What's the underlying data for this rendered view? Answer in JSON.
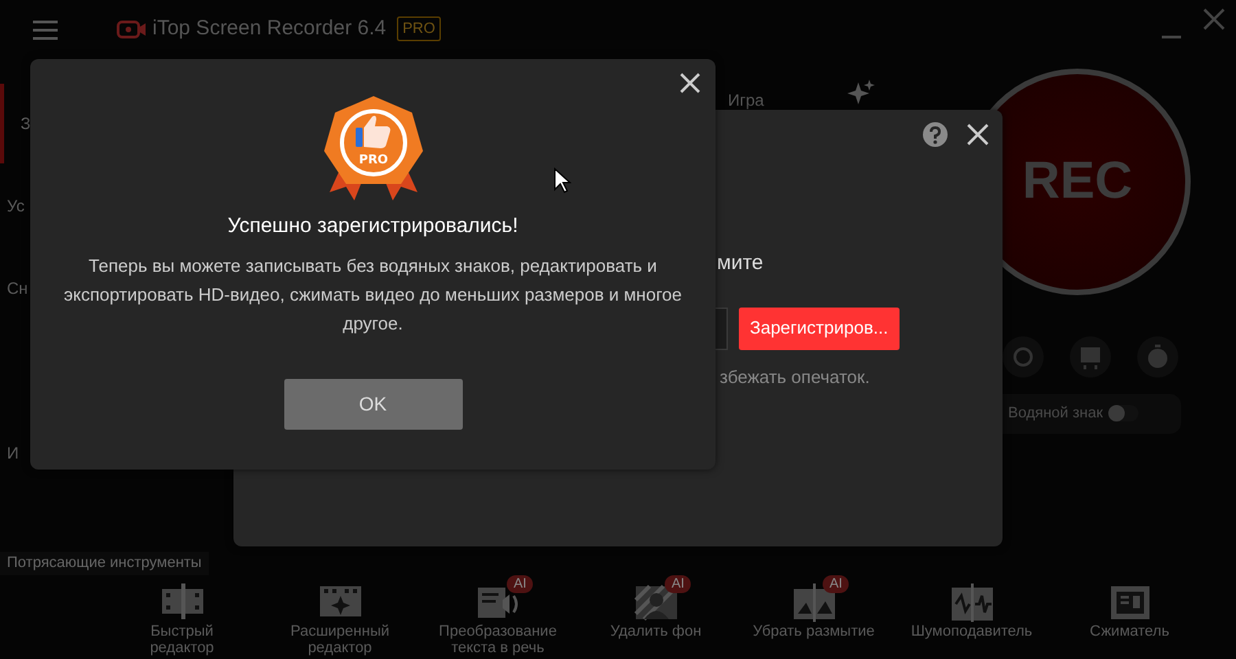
{
  "app": {
    "title": "iTop Screen Recorder 6.4",
    "badge": "PRO"
  },
  "sidebar": {
    "items": [
      {
        "label": "З",
        "selected": true
      },
      {
        "label": "Ус",
        "selected": false
      },
      {
        "label": "Сн",
        "selected": false
      },
      {
        "label": "И",
        "selected": false
      }
    ]
  },
  "mode_tabs": [
    {
      "label": "Игра"
    }
  ],
  "register_dialog": {
    "instruction": "мите",
    "button": "Зарегистриров...",
    "hint": "збежать опечаток."
  },
  "rec_button": {
    "label": "REC"
  },
  "watermark": {
    "label": "Водяной знак",
    "on": false
  },
  "tools": {
    "title": "Потрясающие инструменты",
    "items": [
      {
        "label": "Быстрый\nредактор"
      },
      {
        "label": "Расширенный\nредактор"
      },
      {
        "label": "Преобразование\nтекста в речь",
        "badge": "AI"
      },
      {
        "label": "Удалить фон",
        "badge": "AI"
      },
      {
        "label": "Убрать размытие",
        "badge": "AI"
      },
      {
        "label": "Шумоподавитель"
      },
      {
        "label": "Сжиматель"
      }
    ]
  },
  "success_dialog": {
    "badge_text": "PRO",
    "title": "Успешно зарегистрировались!",
    "message": "Теперь вы можете записывать без водяных знаков, редактировать и экспортировать HD-видео, сжимать видео до меньших размеров и многое другое.",
    "button": "OK"
  }
}
